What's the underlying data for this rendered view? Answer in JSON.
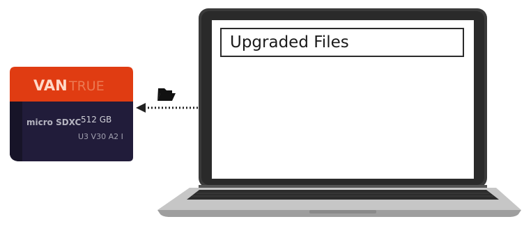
{
  "screen": {
    "title": "Upgraded Files"
  },
  "card": {
    "brand_left": "VAN",
    "brand_right": "TRUE",
    "format_logo": "micro SDXC",
    "capacity": "512 GB",
    "speed_marks": "U3 V30 A2 I"
  },
  "icons": {
    "transfer": "folder-icon",
    "direction": "dotted-arrow-left-icon"
  },
  "colors": {
    "card_top": "#e03c12",
    "card_bottom": "#211c3a",
    "laptop_frame": "#3a3a3a",
    "laptop_base": "#b9b9b9",
    "keyboard": "#2c2c2c",
    "arrow": "#222222"
  }
}
